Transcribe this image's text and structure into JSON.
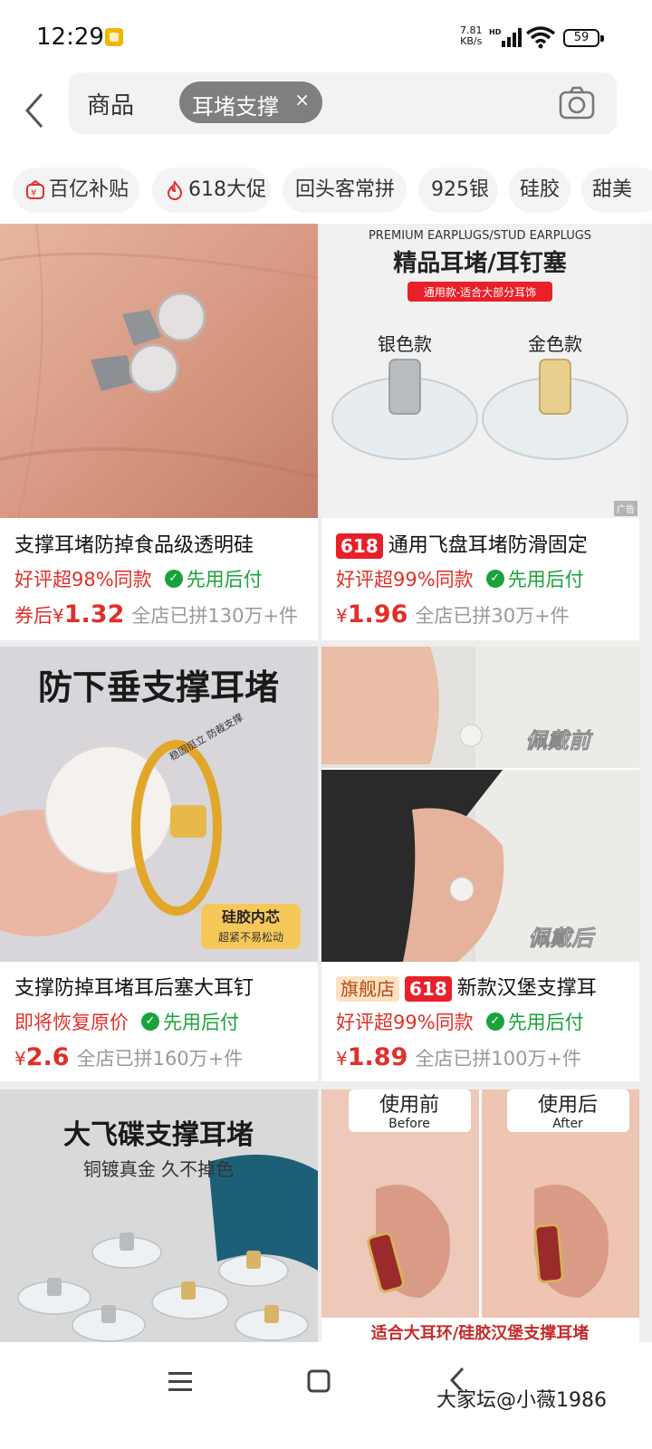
{
  "status_bar": {
    "time": "12:29",
    "speed_value": "7.81",
    "speed_unit": "KB/s",
    "network": "HD",
    "battery": "59"
  },
  "search": {
    "category": "商品",
    "query": "耳堵支撑",
    "clear": "×"
  },
  "filters": [
    {
      "label": "百亿补贴",
      "icon": "wallet-icon"
    },
    {
      "label": "618大促",
      "icon": "flame-icon"
    },
    {
      "label": "回头客常拼"
    },
    {
      "label": "925银"
    },
    {
      "label": "硅胶"
    },
    {
      "label": "甜美"
    }
  ],
  "products": [
    {
      "title": "支撑耳堵防掉食品级透明硅",
      "tags": [],
      "rating": "好评超98%同款",
      "pay": "先用后付",
      "price_prefix": "券后",
      "currency": "¥",
      "price": "1.32",
      "sold": "全店已拼130万+件",
      "image": {}
    },
    {
      "title": "通用飞盘耳堵防滑固定",
      "tags": [
        "618"
      ],
      "rating": "好评超99%同款",
      "pay": "先用后付",
      "price_prefix": "",
      "currency": "¥",
      "price": "1.96",
      "sold": "全店已拼30万+件",
      "ad": "广告",
      "image": {
        "en_title": "PREMIUM EARPLUGS/STUD EARPLUGS",
        "cn_title": "精品耳堵/耳钉塞",
        "banner": "通用款-适合大部分耳饰",
        "left": "银色款",
        "right": "金色款"
      }
    },
    {
      "title": "支撑防掉耳堵耳后塞大耳钉",
      "tags": [],
      "rating": "即将恢复原价",
      "pay": "先用后付",
      "price_prefix": "",
      "currency": "¥",
      "price": "2.6",
      "sold": "全店已拼160万+件",
      "image": {
        "headline": "防下垂支撑耳堵",
        "arc": "稳固挺立 防裁支撑",
        "box1": "硅胶内芯",
        "box2": "超紧不易松动"
      }
    },
    {
      "title": "新款汉堡支撑耳",
      "tags": [
        "旗舰店",
        "618"
      ],
      "rating": "好评超99%同款",
      "pay": "先用后付",
      "price_prefix": "",
      "currency": "¥",
      "price": "1.89",
      "sold": "全店已拼100万+件",
      "image": {
        "before": "佩戴前",
        "after": "佩戴后"
      }
    },
    {
      "title": "",
      "image": {
        "headline": "大飞碟支撑耳堵",
        "sub": "铜镀真金 久不掉色"
      }
    },
    {
      "title": "",
      "image": {
        "before_cn": "使用前",
        "before_en": "Before",
        "after_cn": "使用后",
        "after_en": "After",
        "banner": "适合大耳环/硅胶汉堡支撑耳堵"
      }
    }
  ],
  "watermark": "大家坛@小薇1986"
}
